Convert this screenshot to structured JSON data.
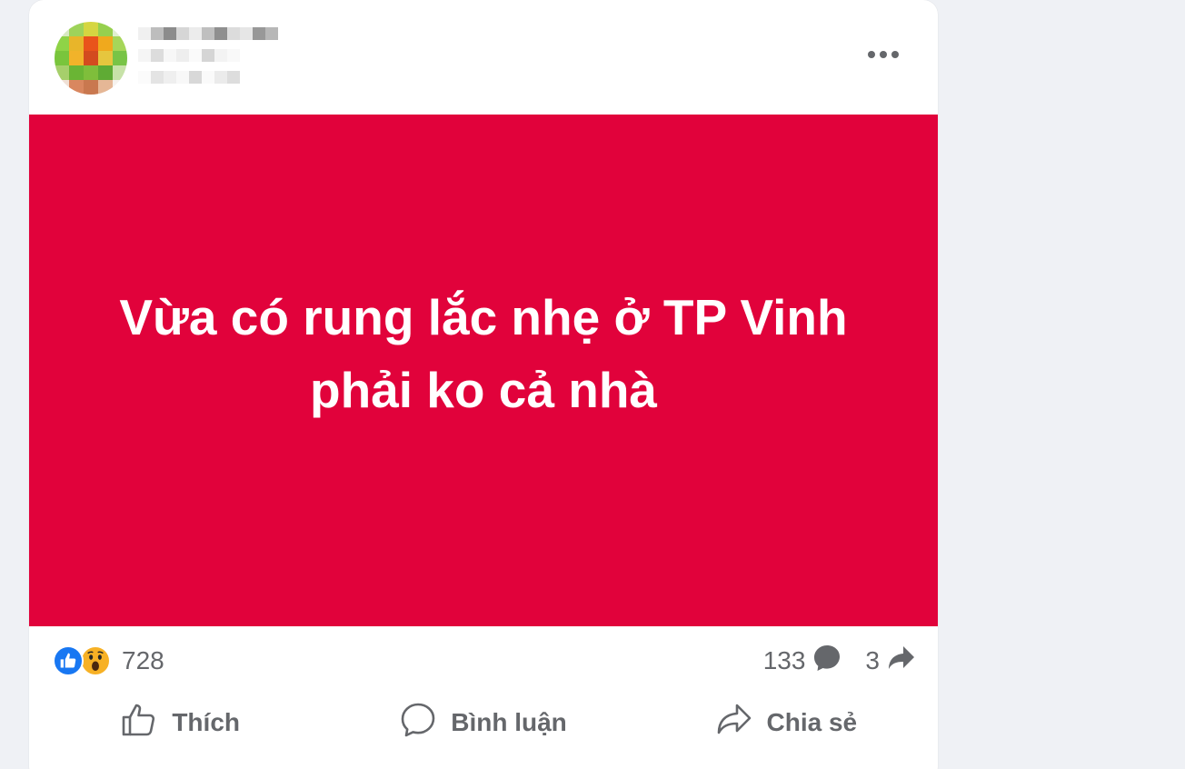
{
  "post": {
    "status_text": "Vừa có rung lắc nhẹ ở TP Vinh phải ko cả nhà",
    "background_color": "#e1023b",
    "text_color": "#ffffff"
  },
  "header": {
    "more_icon": "more-dots-icon"
  },
  "stats": {
    "reaction_icons": [
      "like-icon",
      "wow-icon"
    ],
    "reaction_count": "728",
    "comment_count": "133",
    "share_count": "3"
  },
  "actions": {
    "like_label": "Thích",
    "comment_label": "Bình luận",
    "share_label": "Chia sẻ"
  },
  "colors": {
    "accent_blue": "#1877f2",
    "secondary_text": "#65676b",
    "page_background": "#eff1f5"
  }
}
